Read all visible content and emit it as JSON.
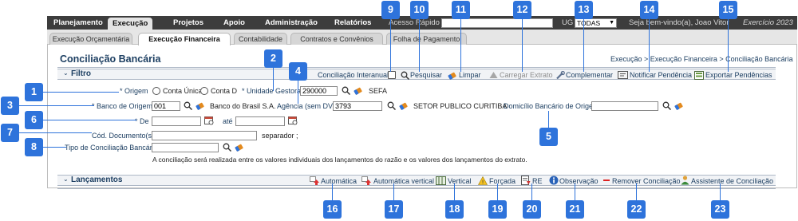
{
  "topnav": {
    "menus": [
      "Planejamento",
      "Execução",
      "Projetos",
      "Apoio",
      "Administração",
      "Relatórios"
    ],
    "quick_access_label": "Acesso Rápido",
    "ug_label": "UG",
    "ug_value": "TODAS",
    "welcome": "Seja bem-vindo(a), Joao Vitor",
    "exercise": "Exercício 2023"
  },
  "subnav": {
    "tabs": [
      "Execução Orçamentária",
      "Execução Financeira",
      "Contabilidade",
      "Contratos e Convênios",
      "Folha de Pagamento"
    ]
  },
  "page": {
    "title": "Conciliação Bancária",
    "breadcrumb": "Execução > Execução Financeira > Conciliação Bancária"
  },
  "filtro": {
    "section_label": "Filtro",
    "actions": {
      "conc_interanual": "Conciliação Interanual",
      "pesquisar": "Pesquisar",
      "limpar": "Limpar",
      "carregar_extrato": "Carregar Extrato",
      "complementar": "Complementar",
      "notificar": "Notificar Pendência",
      "exportar": "Exportar Pendências"
    },
    "origem_label": "* Origem",
    "origem_opt1": "Conta Única",
    "origem_opt2": "Conta D",
    "ug_label": "* Unidade Gestora",
    "ug_value": "290000",
    "ug_desc": "SEFA",
    "banco_label": "* Banco de Origem",
    "banco_value": "001",
    "banco_desc": "Banco do Brasil S.A.",
    "agencia_label": "Agência (sem DV)",
    "agencia_value": "3793",
    "agencia_desc": "SETOR PUBLICO CURITIBA",
    "domicilio_label": "Domicílio Bancário de Origem",
    "de_label": "* De",
    "ate_label": "até",
    "cod_label": "Cód. Documento(s)",
    "separador": "separador ;",
    "tipo_label": "Tipo de Conciliação Bancária",
    "note": "A conciliação será realizada entre os valores individuais dos lançamentos do razão e os valores dos lançamentos do extrato."
  },
  "lancamentos": {
    "section_label": "Lançamentos",
    "actions": {
      "automatica": "Automática",
      "automatica_vertical": "Automática vertical",
      "vertical": "Vertical",
      "forcada": "Forçada",
      "re": "RE",
      "observacao": "Observação",
      "remover": "Remover Conciliação",
      "assistente": "Assistente de Conciliação"
    }
  },
  "callouts": [
    "1",
    "2",
    "3",
    "4",
    "5",
    "6",
    "7",
    "8",
    "9",
    "10",
    "11",
    "12",
    "13",
    "14",
    "15",
    "16",
    "17",
    "18",
    "19",
    "20",
    "21",
    "22",
    "23"
  ],
  "colors": {
    "callout": "#2e73db",
    "topnav": "#3d3d3d",
    "title": "#1d3f62"
  }
}
